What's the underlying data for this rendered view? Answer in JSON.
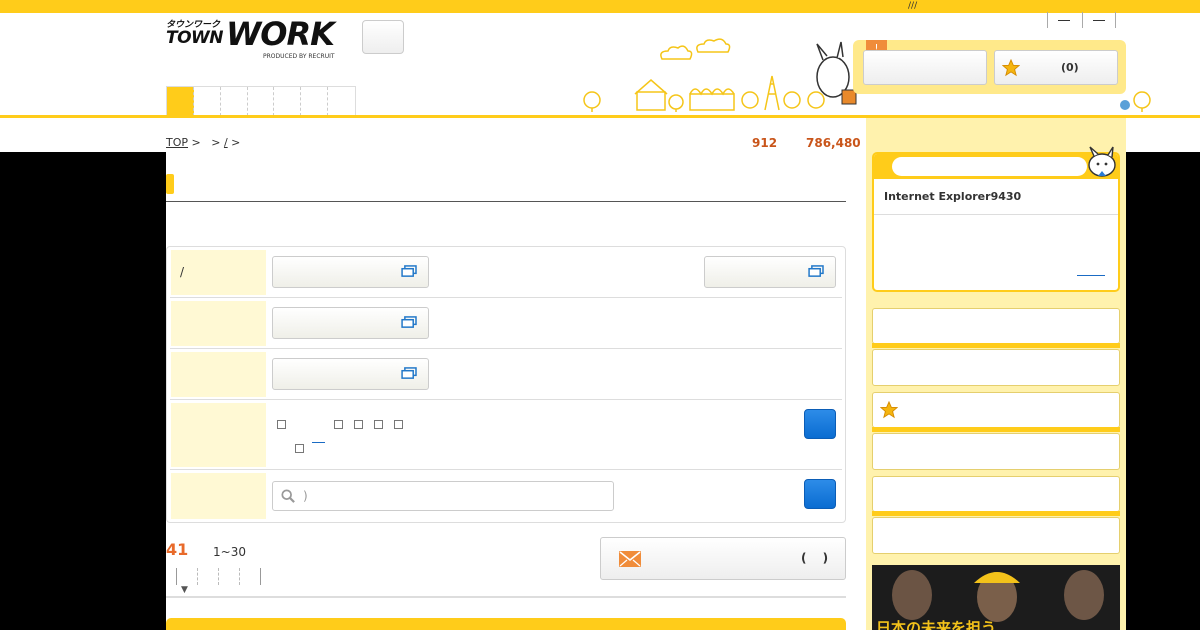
{
  "top_bar": {
    "text": "///"
  },
  "logo": {
    "kana": "タウンワーク",
    "town": "TOWN",
    "work": "WORK",
    "byline": "PRODUCED BY RECRUIT"
  },
  "favorites": {
    "alert_badge": "!",
    "count_label": "(0)"
  },
  "breadcrumb": {
    "top": "TOP",
    "sep1": ">",
    "sep2": ">",
    "mid": "/",
    "sep3": ">"
  },
  "counts": {
    "first": "912",
    "second": "786,480"
  },
  "search": {
    "row1_label": "/",
    "keyword_placeholder": ")"
  },
  "results": {
    "count": "41",
    "range": "1~30",
    "sort_arrow": "▼",
    "mail_paren": "( )"
  },
  "notice": {
    "title": "Internet Explorer9430"
  },
  "banner": {
    "text": "日本の未来を担う"
  },
  "icons": [
    "window-icon",
    "search-icon",
    "star-icon",
    "mail-icon",
    "mascot-icon"
  ],
  "colors": {
    "accent": "#ffcc1a",
    "orange": "#e86a2a",
    "blue": "#0a6cd1",
    "label_bg": "#fff9d4"
  }
}
